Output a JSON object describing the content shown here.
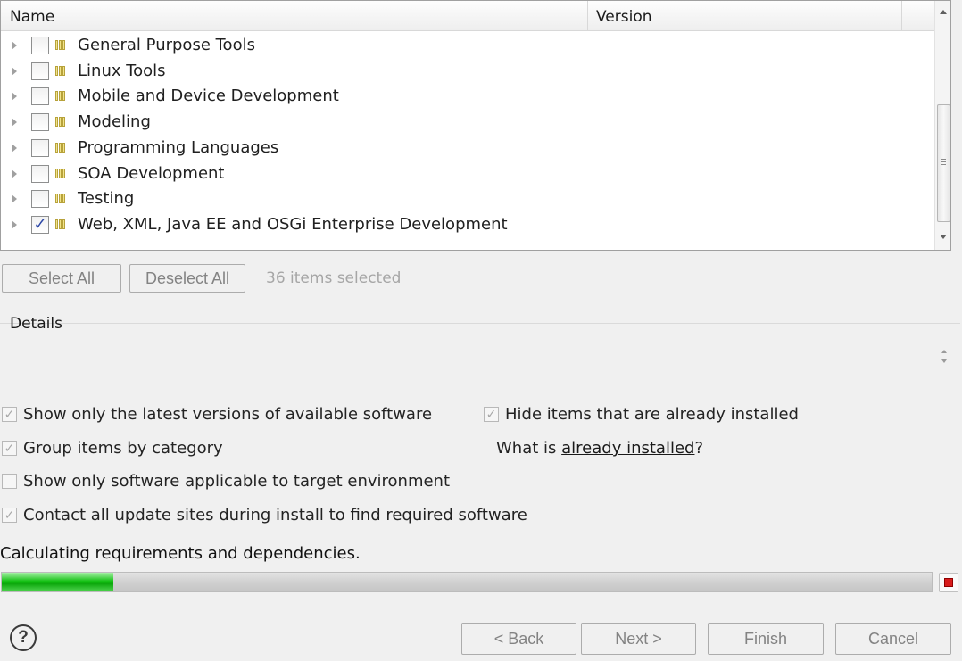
{
  "tree": {
    "columns": {
      "name": "Name",
      "version": "Version"
    },
    "rows": [
      {
        "label": "General Purpose Tools",
        "checked": false
      },
      {
        "label": "Linux Tools",
        "checked": false
      },
      {
        "label": "Mobile and Device Development",
        "checked": false
      },
      {
        "label": "Modeling",
        "checked": false
      },
      {
        "label": "Programming Languages",
        "checked": false
      },
      {
        "label": "SOA Development",
        "checked": false
      },
      {
        "label": "Testing",
        "checked": false
      },
      {
        "label": "Web, XML, Java EE and OSGi Enterprise Development",
        "checked": true
      }
    ]
  },
  "selection": {
    "select_all": "Select All",
    "deselect_all": "Deselect All",
    "count_text": "36 items selected"
  },
  "details": {
    "label": "Details"
  },
  "options": {
    "latest": {
      "label": "Show only the latest versions of available software",
      "checked": true
    },
    "hide_installed": {
      "label": "Hide items that are already installed",
      "checked": true
    },
    "group": {
      "label": "Group items by category",
      "checked": true
    },
    "target_env": {
      "label": "Show only software applicable to target environment",
      "checked": false
    },
    "contact_sites": {
      "label": "Contact all update sites during install to find required software",
      "checked": true
    },
    "what_installed_prefix": "What is ",
    "what_installed_link": "already installed",
    "what_installed_suffix": "?"
  },
  "progress": {
    "label": "Calculating requirements and dependencies.",
    "fraction": 0.12,
    "fill_color": "#16c216"
  },
  "footer": {
    "help": "?",
    "back": "< Back",
    "next": "Next >",
    "finish": "Finish",
    "cancel": "Cancel"
  },
  "icons": {
    "checkmark": "✓",
    "tree_expand": "triangle-right-icon",
    "category": "category-icon",
    "stop": "stop-icon"
  }
}
